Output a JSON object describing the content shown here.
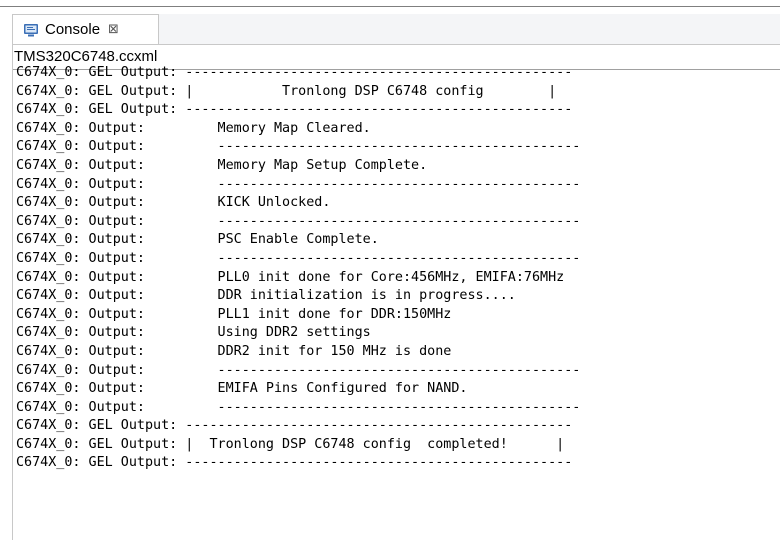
{
  "tab": {
    "label": "Console",
    "close_glyph": "⊠",
    "icon": "console-icon"
  },
  "path": "TMS320C6748.ccxml",
  "console_lines": [
    "C674X_0: GEL Output: ------------------------------------------------",
    "C674X_0: GEL Output: |           Tronlong DSP C6748 config        |",
    "C674X_0: GEL Output: ------------------------------------------------",
    "C674X_0: Output:         Memory Map Cleared.",
    "C674X_0: Output:         ---------------------------------------------",
    "C674X_0: Output:         Memory Map Setup Complete.",
    "C674X_0: Output:         ---------------------------------------------",
    "C674X_0: Output:         KICK Unlocked.",
    "C674X_0: Output:         ---------------------------------------------",
    "C674X_0: Output:         PSC Enable Complete.",
    "C674X_0: Output:         ---------------------------------------------",
    "C674X_0: Output:         PLL0 init done for Core:456MHz, EMIFA:76MHz",
    "C674X_0: Output:         DDR initialization is in progress....",
    "C674X_0: Output:         PLL1 init done for DDR:150MHz",
    "C674X_0: Output:         Using DDR2 settings",
    "C674X_0: Output:         DDR2 init for 150 MHz is done",
    "C674X_0: Output:         ---------------------------------------------",
    "C674X_0: Output:         EMIFA Pins Configured for NAND.",
    "C674X_0: Output:         ---------------------------------------------",
    "C674X_0: GEL Output: ------------------------------------------------",
    "C674X_0: GEL Output: |  Tronlong DSP C6748 config  completed!      |",
    "C674X_0: GEL Output: ------------------------------------------------"
  ]
}
